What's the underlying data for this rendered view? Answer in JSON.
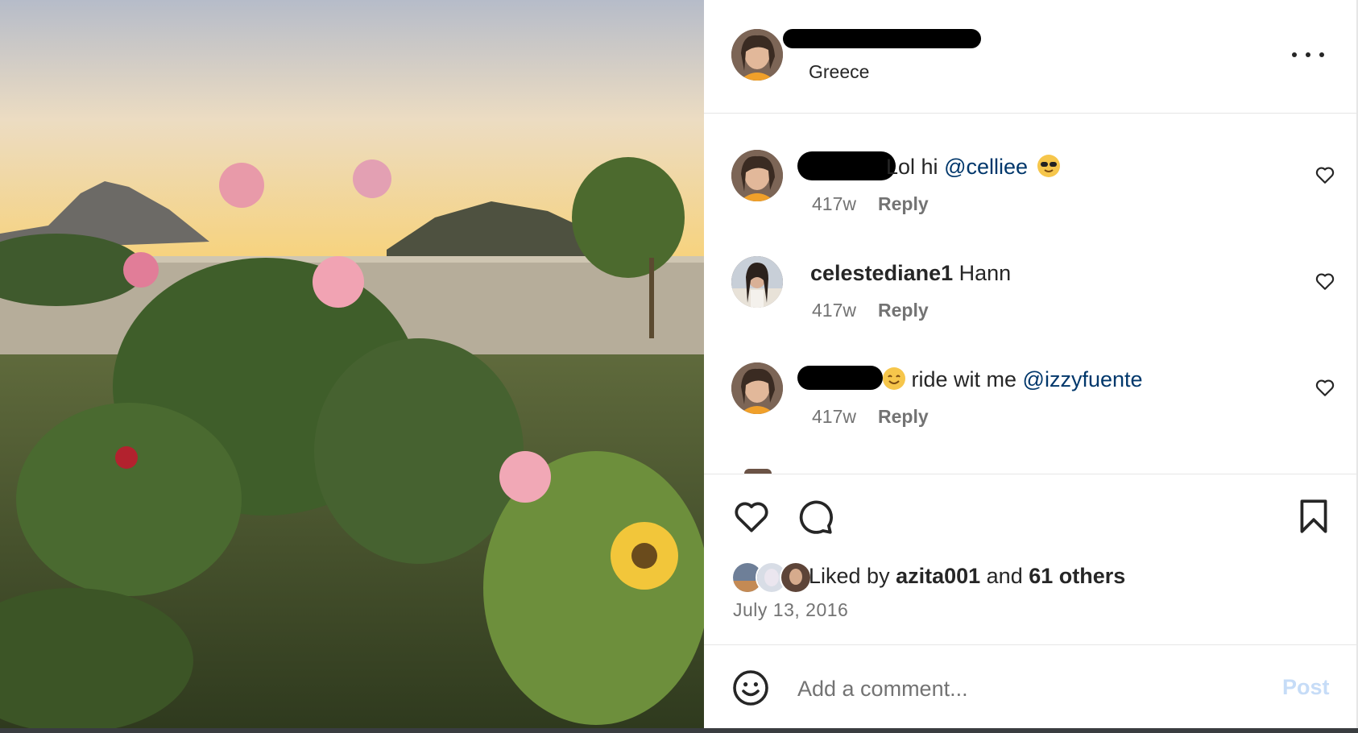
{
  "post": {
    "location": "Greece",
    "more_icon": "more-horizontal-icon"
  },
  "comments": [
    {
      "user_redacted": true,
      "text": "Lol hi ",
      "mention": "@celliee",
      "emoji": "smiling-face-with-sunglasses",
      "time": "417w",
      "reply_label": "Reply"
    },
    {
      "username": "celestediane1",
      "text": " Hann",
      "time": "417w",
      "reply_label": "Reply"
    },
    {
      "user_redacted": true,
      "emoji": "smiling-face",
      "text": " ride wit me ",
      "mention": "@izzyfuente",
      "time": "417w",
      "reply_label": "Reply"
    }
  ],
  "actions": {
    "like_icon": "heart-icon",
    "comment_icon": "comment-icon",
    "save_icon": "bookmark-icon"
  },
  "likes": {
    "prefix": "Liked by ",
    "user": "azita001",
    "middle": " and ",
    "others": "61 others"
  },
  "date": "July 13, 2016",
  "composer": {
    "placeholder": "Add a comment...",
    "post_label": "Post"
  },
  "colors": {
    "mention": "#00376b",
    "secondary_text": "#737373",
    "post_button_disabled": "#c6dcf7",
    "divider": "#e6e6e6"
  }
}
